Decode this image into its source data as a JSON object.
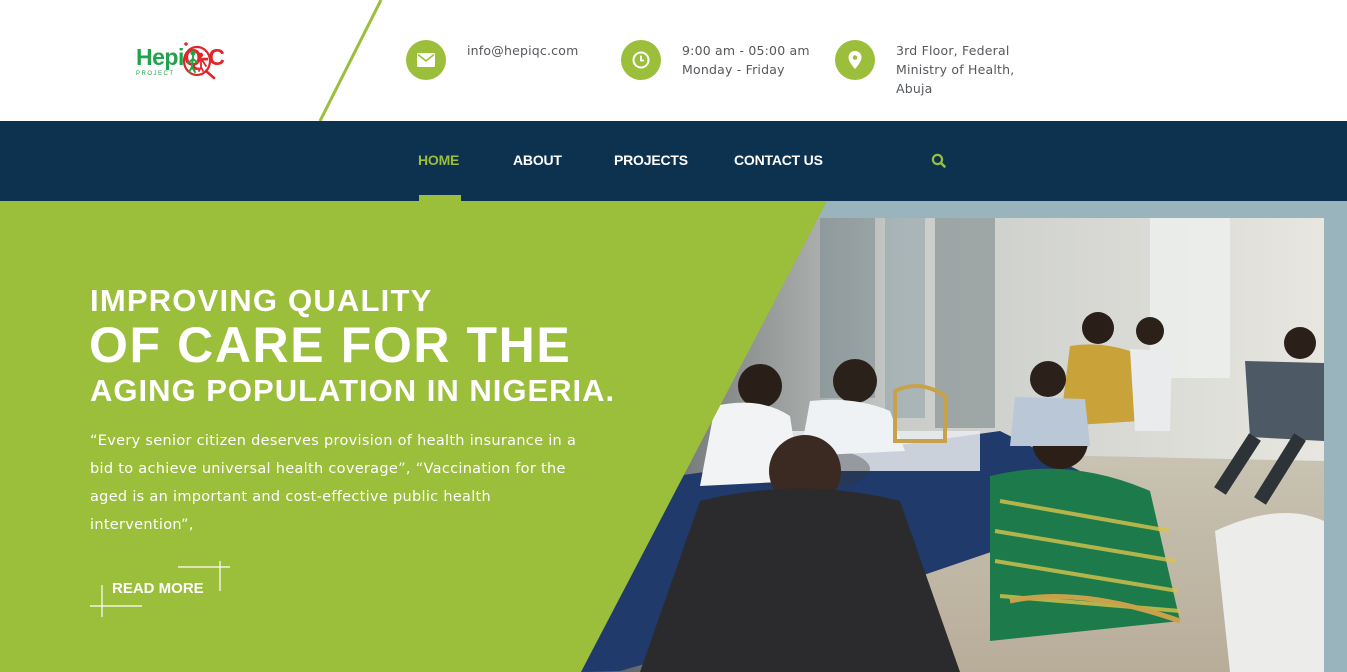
{
  "brand": {
    "name_main": "Hepi",
    "name_mid": "Q",
    "name_suffix": "-C",
    "tagline": "PROJECT"
  },
  "contact": {
    "email": {
      "icon": "envelope-icon",
      "line1": "info@hepiqc.com"
    },
    "hours": {
      "icon": "clock-icon",
      "line1": "9:00 am - 05:00 am",
      "line2": "Monday - Friday"
    },
    "address": {
      "icon": "map-pin-icon",
      "line1": "3rd Floor, Federal",
      "line2": "Ministry of Health,",
      "line3": "Abuja"
    }
  },
  "nav": {
    "items": [
      {
        "label": "HOME",
        "active": true
      },
      {
        "label": "ABOUT",
        "active": false
      },
      {
        "label": "PROJECTS",
        "active": false
      },
      {
        "label": "CONTACT US",
        "active": false
      }
    ],
    "search_icon": "search-icon"
  },
  "hero": {
    "title_line1": "IMPROVING QUALITY",
    "title_line2": "OF CARE FOR THE",
    "title_line3": "AGING POPULATION IN NIGERIA.",
    "quote": "“Every senior citizen deserves provision of health insurance in a bid to achieve universal health coverage”, “Vaccination for the aged is an important and cost-effective public health intervention”,",
    "cta_label": "READ MORE"
  },
  "colors": {
    "accent_green": "#9bbe3b",
    "nav_navy": "#0d3250",
    "logo_green": "#21a34b",
    "logo_red": "#e0262b",
    "hero_frame": "#9ab4be"
  }
}
